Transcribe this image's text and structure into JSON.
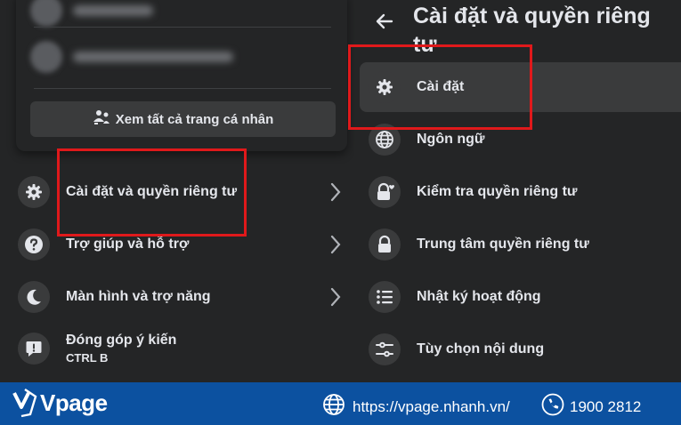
{
  "left_panel": {
    "see_all_label": "Xem tất cả trang cá nhân",
    "menu": [
      {
        "label": "Cài đặt và quyền riêng tư",
        "icon": "gear-icon",
        "has_chevron": true
      },
      {
        "label": "Trợ giúp và hỗ trợ",
        "icon": "help-icon",
        "has_chevron": true
      },
      {
        "label": "Màn hình và trợ năng",
        "icon": "moon-icon",
        "has_chevron": true
      },
      {
        "label": "Đóng góp ý kiến",
        "sub": "CTRL B",
        "icon": "feedback-icon",
        "has_chevron": false
      }
    ]
  },
  "right_panel": {
    "title": "Cài đặt và quyền riêng tư",
    "items": [
      {
        "label": "Cài đặt",
        "icon": "gear-icon",
        "active": true
      },
      {
        "label": "Ngôn ngữ",
        "icon": "globe-icon"
      },
      {
        "label": "Kiểm tra quyền riêng tư",
        "icon": "lock-heart-icon"
      },
      {
        "label": "Trung tâm quyền riêng tư",
        "icon": "lock-icon"
      },
      {
        "label": "Nhật ký hoạt động",
        "icon": "list-icon"
      },
      {
        "label": "Tùy chọn nội dung",
        "icon": "sliders-icon"
      }
    ]
  },
  "banner": {
    "brand": "Vpage",
    "url": "https://vpage.nhanh.vn/",
    "phone": "1900 2812"
  },
  "colors": {
    "background": "#18191a",
    "panel": "#242526",
    "hover": "#3a3b3c",
    "text": "#e4e6eb",
    "highlight_border": "#e0191b",
    "banner": "#0c51a0"
  }
}
